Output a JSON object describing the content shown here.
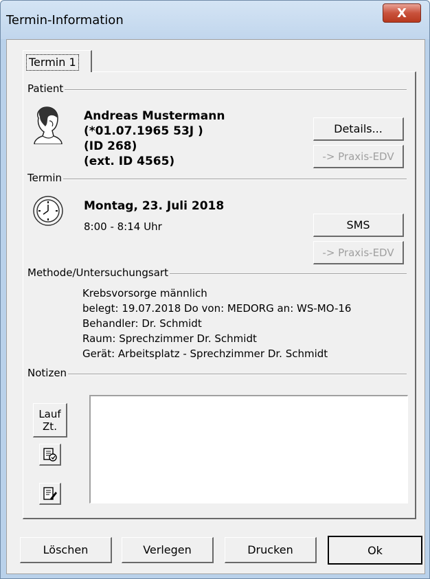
{
  "window": {
    "title": "Termin-Information",
    "close_symbol": "X"
  },
  "tabs": [
    {
      "label": "Termin 1"
    }
  ],
  "patient": {
    "section_label": "Patient",
    "name": "Andreas Mustermann",
    "birth": "(*01.07.1965 53J )",
    "id": "(ID 268)",
    "ext_id": "(ext. ID 4565)",
    "icon": "patient-head-icon",
    "details_button": "Details...",
    "praxis_button": "-> Praxis-EDV"
  },
  "termin": {
    "section_label": "Termin",
    "date": "Montag, 23. Juli 2018",
    "time": "8:00 - 8:14 Uhr",
    "icon": "clock-icon",
    "sms_button": "SMS",
    "praxis_button": "-> Praxis-EDV"
  },
  "methode": {
    "section_label": "Methode/Untersuchungsart",
    "lines": [
      "Krebsvorsorge männlich",
      "belegt: 19.07.2018 Do von: MEDORG an: WS-MO-16",
      "Behandler: Dr. Schmidt",
      "Raum: Sprechzimmer Dr. Schmidt",
      "Gerät: Arbeitsplatz - Sprechzimmer Dr. Schmidt"
    ]
  },
  "notizen": {
    "section_label": "Notizen",
    "lauf_line1": "Lauf",
    "lauf_line2": "Zt.",
    "value": ""
  },
  "footer": {
    "loeschen": "Löschen",
    "verlegen": "Verlegen",
    "drucken": "Drucken",
    "ok": "Ok"
  },
  "colors": {
    "dialog_bg": "#f0f0f0",
    "title_bg": "#c9dcf0",
    "close_red": "#c9523c",
    "disabled_text": "#a0a0a0"
  }
}
